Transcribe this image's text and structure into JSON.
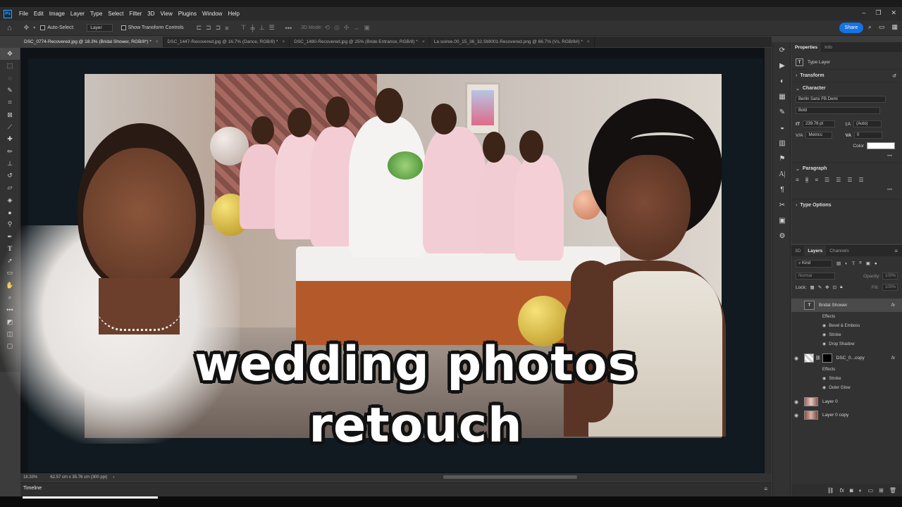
{
  "menubar": {
    "items": [
      "File",
      "Edit",
      "Image",
      "Layer",
      "Type",
      "Select",
      "Filter",
      "3D",
      "View",
      "Plugins",
      "Window",
      "Help"
    ]
  },
  "options": {
    "auto_select_label": "Auto-Select:",
    "auto_select_value": "Layer",
    "transform_controls_label": "Show Transform Controls",
    "mode_3d_label": "3D Mode:",
    "share_label": "Share"
  },
  "tabs": [
    {
      "label": "DSC_0774-Recovered.jpg @ 18.3% (Bridal Shower, RGB/8*) *",
      "active": true
    },
    {
      "label": "DSC_1447-Recovered.jpg @ 16.7% (Dance, RGB/8) *",
      "active": false
    },
    {
      "label": "DSC_1480-Recovered.jpg @ 25% (Bride  Entrance, RGB/8) *",
      "active": false
    },
    {
      "label": "La soiree.00_15_36_32.Still001-Recovered.png @ 66.7% (Vs, RGB/8#) *",
      "active": false
    }
  ],
  "canvas": {
    "headline_line1": "wedding photos",
    "headline_line2": "retouch"
  },
  "status": {
    "zoom": "18.33%",
    "dimensions": "62.57 cm x 35.76 cm (300 ppi)",
    "timeline_label": "Timeline"
  },
  "properties": {
    "tab_properties": "Properties",
    "tab_info": "Info",
    "type_layer_label": "Type Layer",
    "transform_label": "Transform",
    "character_label": "Character",
    "font_family": "Berlin Sans FB Demi",
    "font_style": "Bold",
    "font_size": "239.76 pt",
    "leading": "(Auto)",
    "kerning": "Metrics",
    "tracking": "0",
    "color_label": "Color",
    "paragraph_label": "Paragraph",
    "type_options_label": "Type Options"
  },
  "layers_panel": {
    "tab_3d": "3D",
    "tab_layers": "Layers",
    "tab_channels": "Channels",
    "kind_filter": "Kind",
    "blend_mode": "Normal",
    "opacity_label": "Opacity:",
    "opacity_value": "100%",
    "lock_label": "Lock:",
    "fill_label": "Fill:",
    "fill_value": "100%",
    "layers": [
      {
        "name": "Bridal Shower",
        "selected": true,
        "effects_label": "Effects",
        "effects": [
          "Bevel & Emboss",
          "Stroke",
          "Drop Shadow"
        ]
      },
      {
        "name": "DSC_0...copy",
        "selected": false,
        "effects_label": "Effects",
        "effects": [
          "Stroke",
          "Outer Glow"
        ]
      },
      {
        "name": "Layer 0",
        "selected": false
      },
      {
        "name": "Layer 0 copy",
        "selected": false
      }
    ]
  },
  "colors": {
    "accent": "#1473e6",
    "panel_bg": "#323232",
    "canvas_bg": "#0f1318"
  }
}
